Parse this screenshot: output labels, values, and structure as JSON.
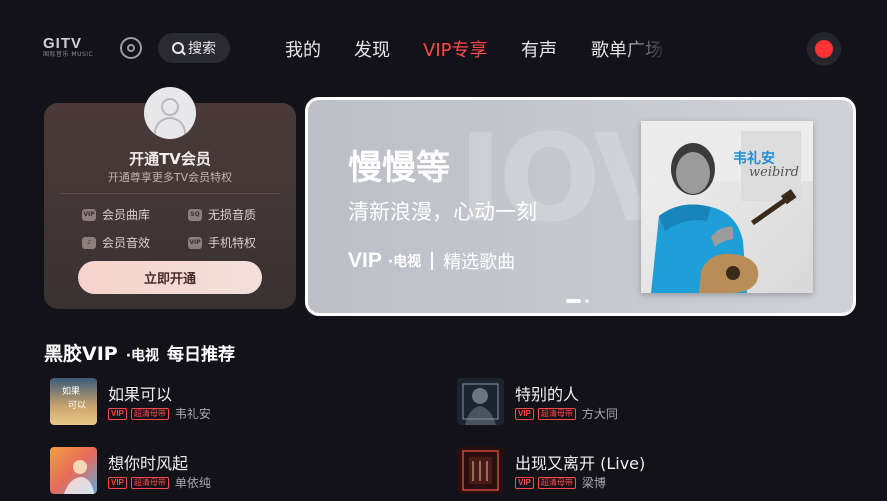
{
  "header": {
    "logo_text": "GITV",
    "logo_sub": "国际音乐 MUSIC",
    "search_label": "搜索",
    "tabs": [
      "我的",
      "发现",
      "VIP专享",
      "有声",
      "歌单广场"
    ],
    "active_tab": 2
  },
  "member_card": {
    "title": "开通TV会员",
    "subtitle": "开通尊享更多TV会员特权",
    "perks": [
      {
        "icon": "vip-icon",
        "label": "会员曲库"
      },
      {
        "icon": "sq-icon",
        "label": "无损音质"
      },
      {
        "icon": "sound-effect-icon",
        "label": "会员音效"
      },
      {
        "icon": "phone-vip-icon",
        "label": "手机特权"
      }
    ],
    "button_label": "立即开通"
  },
  "banner": {
    "title": "慢慢等",
    "subtitle": "清新浪漫，心动一刻",
    "tag_vip": "VIP",
    "tag_tv": "·电视",
    "tag_label": "精选歌曲",
    "watermark": "IOVE",
    "album_text": "weibird",
    "album_artist_cn": "韦礼安",
    "pages": 2,
    "current_page": 0
  },
  "section": {
    "brand": "黑胶VIP",
    "tv": "·电视",
    "title": "每日推荐"
  },
  "songs": [
    {
      "title": "如果可以",
      "vip": "VIP",
      "hq": "超清母带",
      "artist": "韦礼安"
    },
    {
      "title": "特别的人",
      "vip": "VIP",
      "hq": "超清母带",
      "artist": "方大同"
    },
    {
      "title": "想你时风起",
      "vip": "VIP",
      "hq": "超清母带",
      "artist": "单依纯"
    },
    {
      "title": "出现又离开 (Live)",
      "vip": "VIP",
      "hq": "超清母带",
      "artist": "梁博"
    }
  ],
  "colors": {
    "accent": "#ff4a4a",
    "background": "#121218",
    "record": "#ff3333"
  }
}
